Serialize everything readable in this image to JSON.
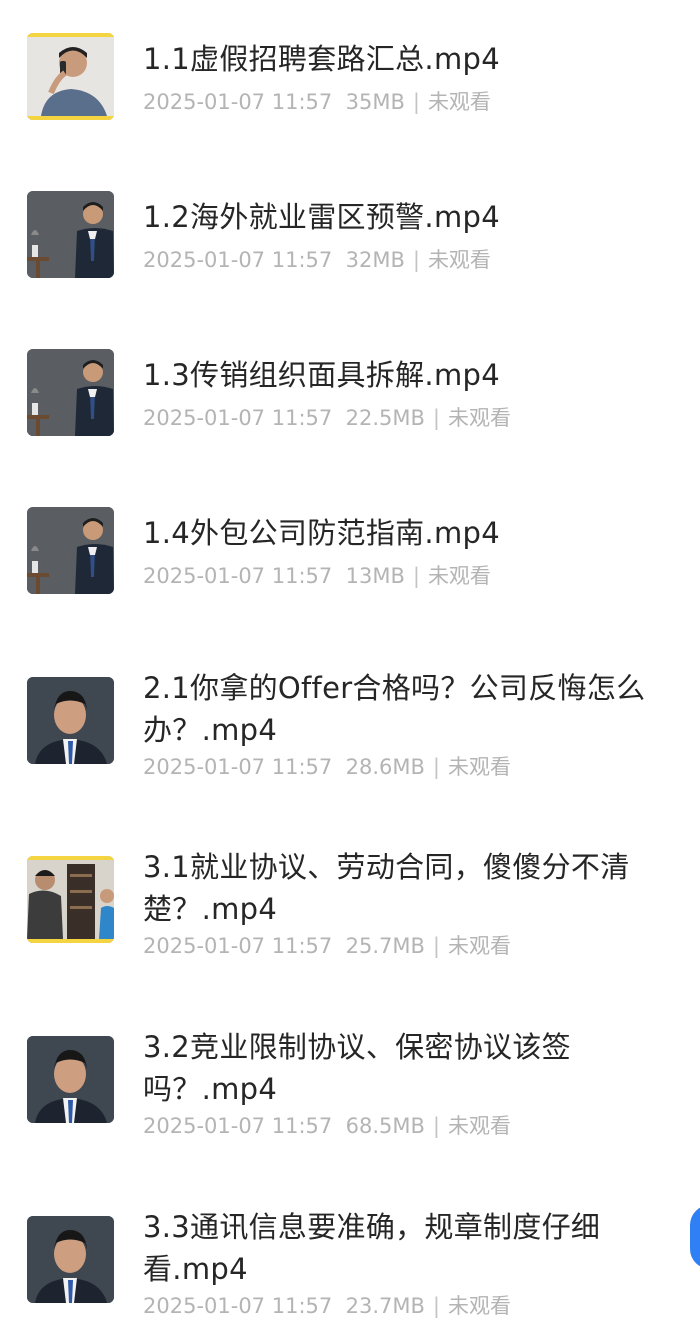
{
  "files": [
    {
      "title": "1.1虚假招聘套路汇总.mp4",
      "date": "2025-01-07 11:57",
      "size": "35MB",
      "status": "未观看",
      "thumb": "phone"
    },
    {
      "title": "1.2海外就业雷区预警.mp4",
      "date": "2025-01-07 11:57",
      "size": "32MB",
      "status": "未观看",
      "thumb": "seated"
    },
    {
      "title": "1.3传销组织面具拆解.mp4",
      "date": "2025-01-07 11:57",
      "size": "22.5MB",
      "status": "未观看",
      "thumb": "seated"
    },
    {
      "title": "1.4外包公司防范指南.mp4",
      "date": "2025-01-07 11:57",
      "size": "13MB",
      "status": "未观看",
      "thumb": "seated"
    },
    {
      "title": "2.1你拿的Offer合格吗？公司反悔怎么办？.mp4",
      "date": "2025-01-07 11:57",
      "size": "28.6MB",
      "status": "未观看",
      "thumb": "portrait"
    },
    {
      "title": "3.1就业协议、劳动合同，傻傻分不清楚？.mp4",
      "date": "2025-01-07 11:57",
      "size": "25.7MB",
      "status": "未观看",
      "thumb": "room"
    },
    {
      "title": "3.2竞业限制协议、保密协议该签吗？.mp4",
      "date": "2025-01-07 11:57",
      "size": "68.5MB",
      "status": "未观看",
      "thumb": "portrait"
    },
    {
      "title": "3.3通讯信息要准确，规章制度仔细看.mp4",
      "date": "2025-01-07 11:57",
      "size": "23.7MB",
      "status": "未观看",
      "thumb": "portrait"
    }
  ],
  "colors": {
    "accent_yellow": "#f5d442",
    "fab_blue": "#2f7ff5"
  }
}
